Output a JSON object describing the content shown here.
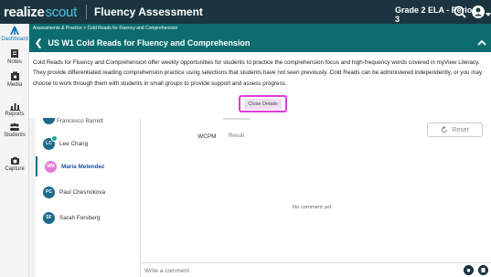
{
  "topbar": {
    "logo_part1": "realize",
    "logo_part2": "scout",
    "app_title": "Fluency Assessment",
    "class_label": "Grade 2 ELA - Period 3"
  },
  "rail": {
    "items": [
      {
        "label": "Dashboard",
        "icon": "dashboard-icon"
      },
      {
        "label": "Notes",
        "icon": "notes-icon"
      },
      {
        "label": "Media",
        "icon": "media-icon"
      },
      {
        "label": "Reports",
        "icon": "reports-icon"
      },
      {
        "label": "Students",
        "icon": "students-icon"
      },
      {
        "label": "Capture",
        "icon": "camera-icon"
      }
    ]
  },
  "breadcrumb": "Assessments & Practice > Cold Reads for Fluency and Comprehension",
  "header": {
    "title": "US W1 Cold Reads for Fluency and Comprehension"
  },
  "description": "Cold Reads for Fluency and Comprehension offer weekly opportunities for students to practice the comprehension focus and high-frequency words covered in myView Literacy.  They provide differentiated reading comprehension practice using selections that students have not seen previously. Cold Reads can be administered independently, or you may choose to work through them with students in small groups to provide support and assess progress.",
  "close_details_label": "Close Details",
  "students": {
    "partial_name": "Francesco Barrett",
    "list": [
      {
        "initials": "LC",
        "name": "Lee Chang",
        "checked": true
      },
      {
        "initials": "MM",
        "name": "Maria Melendez",
        "selected": true
      },
      {
        "initials": "PC",
        "name": "Paul Chesnokova"
      },
      {
        "initials": "SF",
        "name": "Sarah Forsberg"
      }
    ]
  },
  "content": {
    "wcpm_label": "WCPM",
    "result_label": "Result",
    "reset_label": "Reset",
    "no_comment": "No comment yet"
  },
  "comment": {
    "placeholder": "Write a comment"
  },
  "colors": {
    "topbar": "#1b3540",
    "teal": "#0d6d6e",
    "accent": "#4fc3e8",
    "highlight": "#e03bd8"
  }
}
